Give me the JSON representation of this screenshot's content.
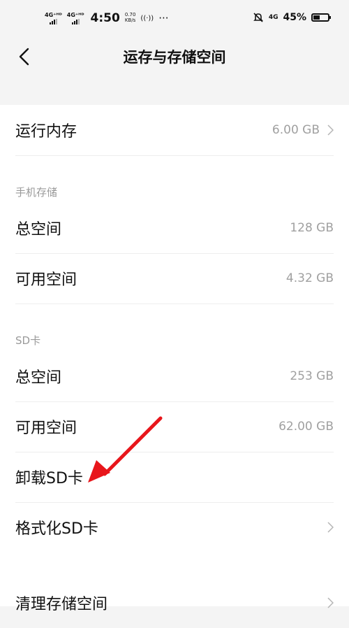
{
  "status_bar": {
    "network1": "4G⁺ᴴᴰ",
    "network2": "4G⁺ᴴᴰ",
    "time": "4:50",
    "speed_value": "0.70",
    "speed_unit": "KB/s",
    "hotspot": "((·))",
    "more": "···",
    "data_type": "4G",
    "battery": "45%",
    "battery_level": 0.45
  },
  "header": {
    "title": "运存与存储空间"
  },
  "ram": {
    "label": "运行内存",
    "value": "6.00 GB"
  },
  "phone_storage": {
    "section": "手机存储",
    "total_label": "总空间",
    "total_value": "128 GB",
    "free_label": "可用空间",
    "free_value": "4.32 GB"
  },
  "sd_card": {
    "section": "SD卡",
    "total_label": "总空间",
    "total_value": "253 GB",
    "free_label": "可用空间",
    "free_value": "62.00 GB",
    "unmount_label": "卸载SD卡",
    "format_label": "格式化SD卡"
  },
  "cleanup": {
    "label": "清理存储空间"
  },
  "annotation_color": "#e8161b"
}
